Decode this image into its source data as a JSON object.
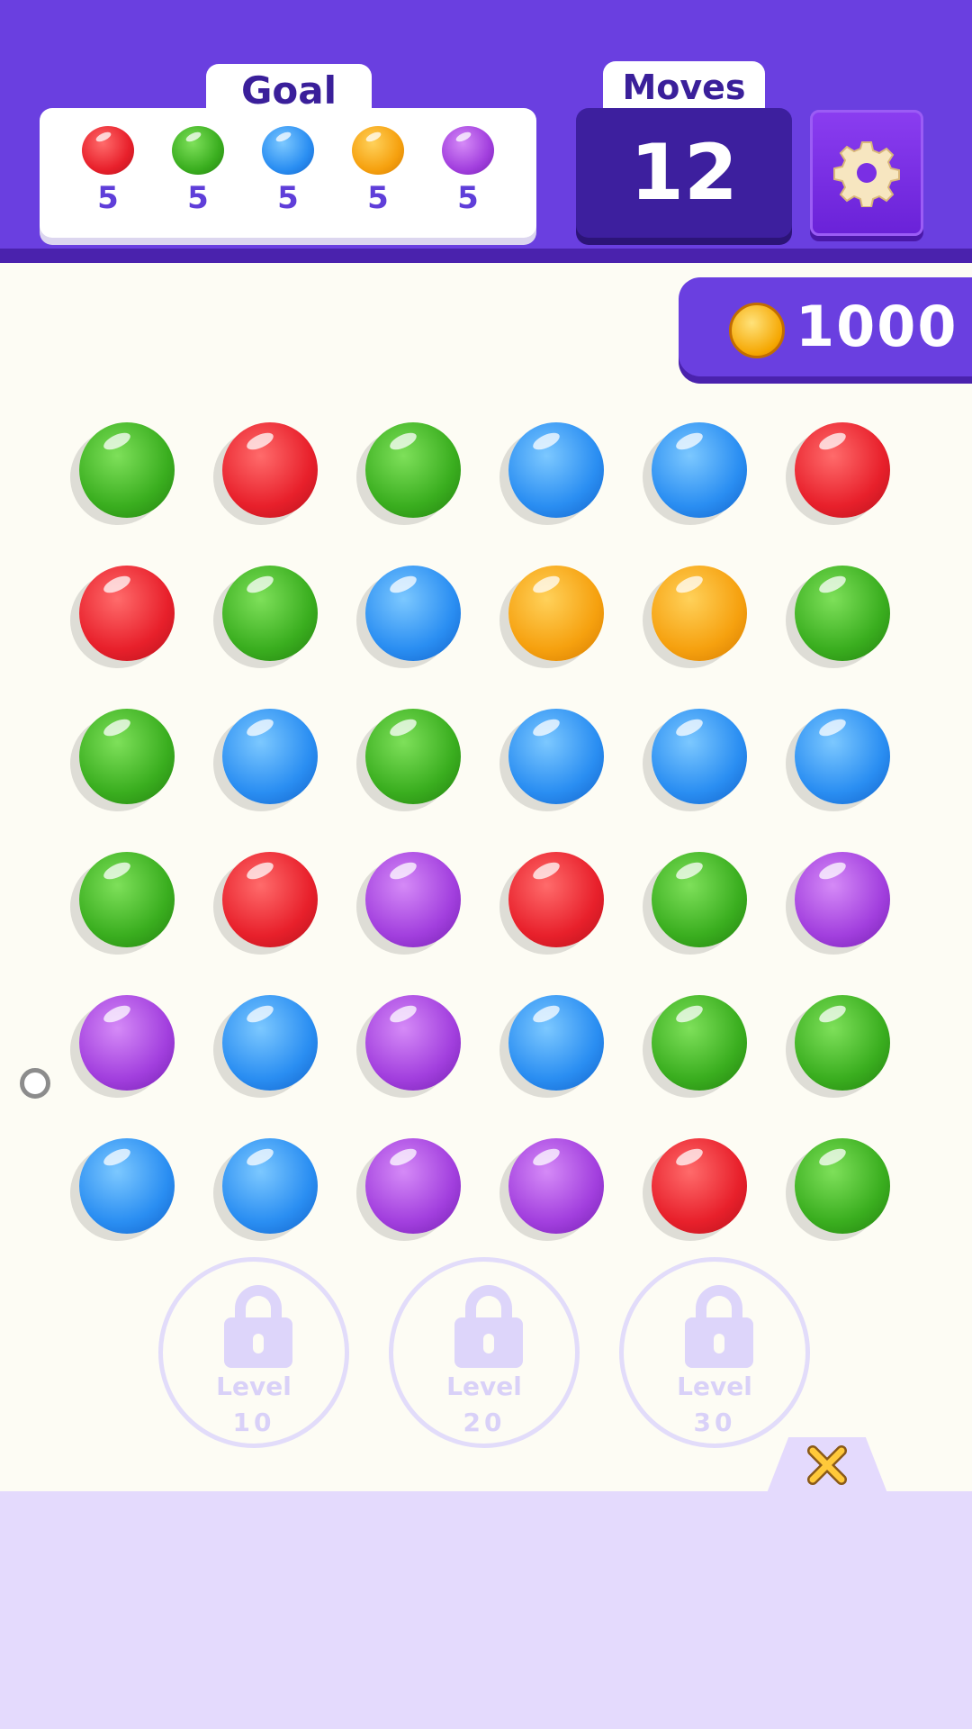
{
  "header": {
    "goal_label": "Goal",
    "moves_label": "Moves",
    "moves_value": "12",
    "settings_icon": "gear-icon",
    "goals": [
      {
        "color": "red",
        "count": "5"
      },
      {
        "color": "green",
        "count": "5"
      },
      {
        "color": "blue",
        "count": "5"
      },
      {
        "color": "orange",
        "count": "5"
      },
      {
        "color": "purple",
        "count": "5"
      }
    ]
  },
  "coins": {
    "value": "1000",
    "icon": "coin-icon"
  },
  "board": {
    "rows": [
      [
        "green",
        "red",
        "green",
        "blue",
        "blue",
        "red"
      ],
      [
        "red",
        "green",
        "blue",
        "orange",
        "orange",
        "green"
      ],
      [
        "green",
        "blue",
        "green",
        "blue",
        "blue",
        "blue"
      ],
      [
        "green",
        "red",
        "purple",
        "red",
        "green",
        "purple"
      ],
      [
        "purple",
        "blue",
        "purple",
        "blue",
        "green",
        "green"
      ],
      [
        "blue",
        "blue",
        "purple",
        "purple",
        "red",
        "green"
      ]
    ]
  },
  "boosters": [
    {
      "label": "Level",
      "level": "10",
      "icon": "lock-icon"
    },
    {
      "label": "Level",
      "level": "20",
      "icon": "lock-icon"
    },
    {
      "label": "Level",
      "level": "30",
      "icon": "lock-icon"
    }
  ],
  "close_icon": "close-icon",
  "colors": {
    "header_bg": "#6a3fe0",
    "board_bg": "#fdfcf4",
    "bottom_panel": "#e4dafd"
  }
}
